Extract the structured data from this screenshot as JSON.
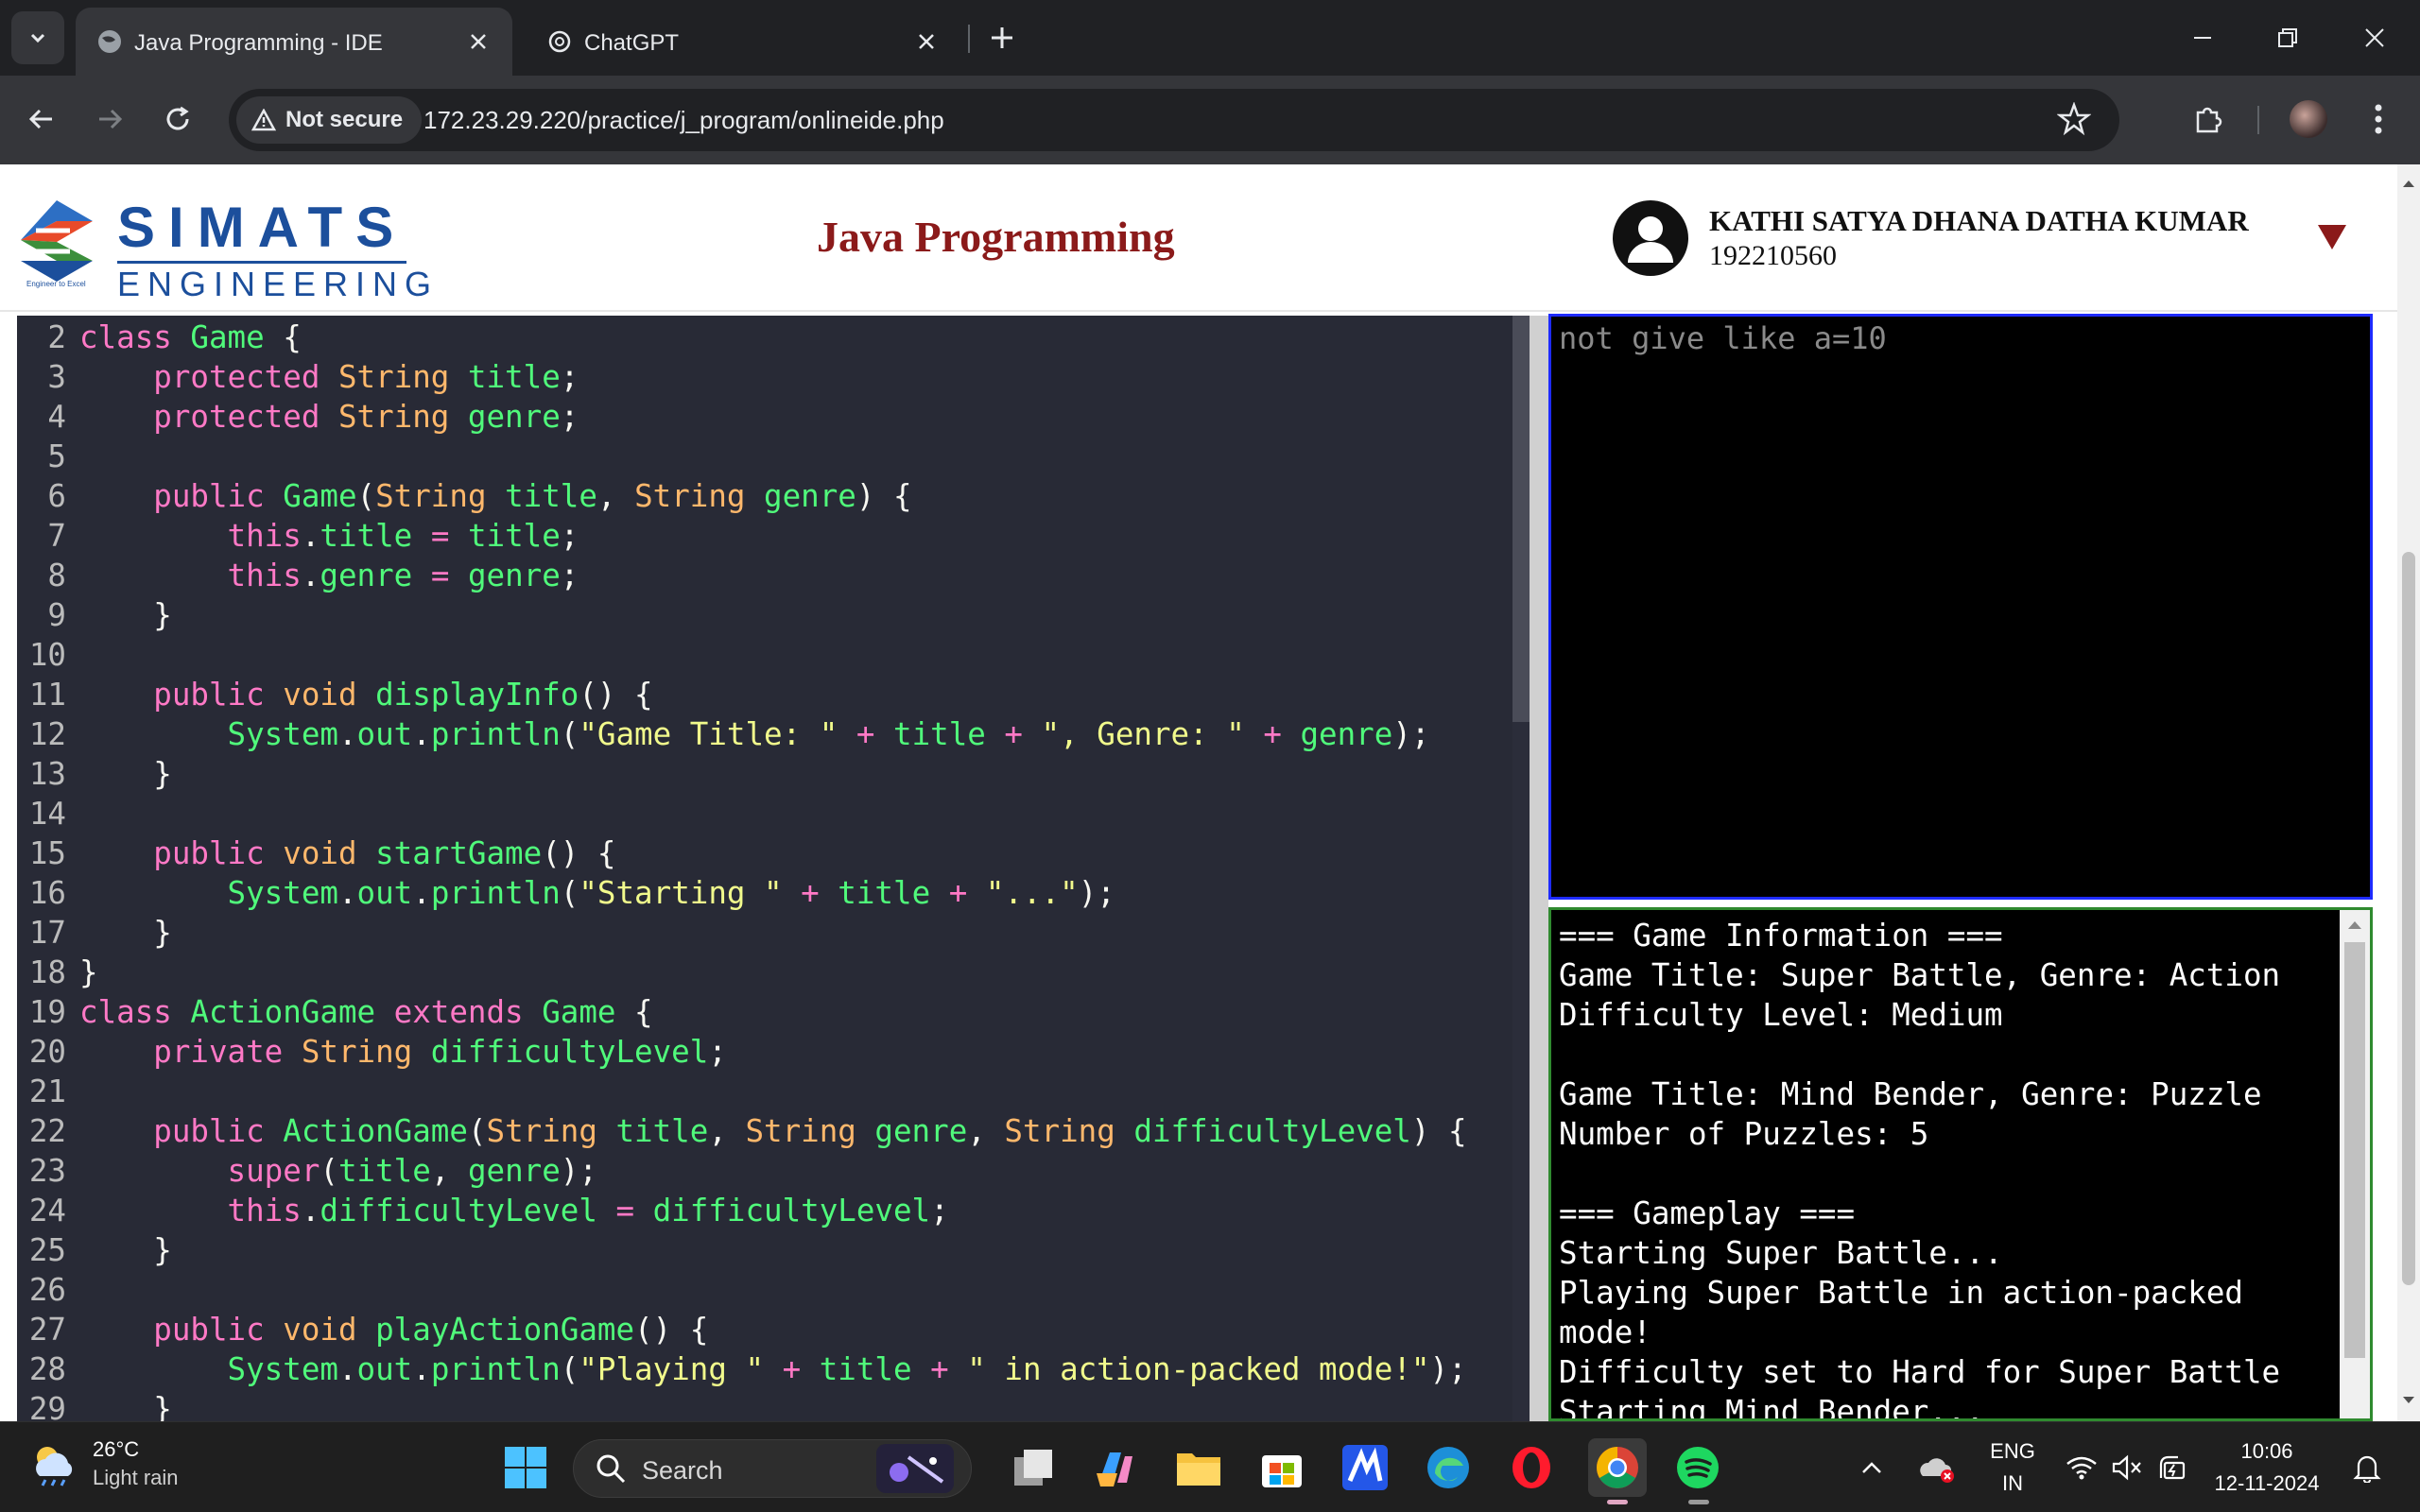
{
  "browser": {
    "tabs": [
      {
        "title": "Java Programming - IDE",
        "active": true
      },
      {
        "title": "ChatGPT",
        "active": false
      }
    ],
    "security_label": "Not secure",
    "url": "172.23.29.220/practice/j_program/onlineide.php"
  },
  "header": {
    "logo_word": "SIMATS",
    "logo_sub": "ENGINEERING",
    "logo_tagline": "Engineer to Excel",
    "title": "Java Programming",
    "user_name": "KATHI SATYA DHANA DATHA KUMAR",
    "user_id": "192210560"
  },
  "editor": {
    "lines": [
      {
        "n": "2",
        "tokens": [
          [
            "kw",
            "class "
          ],
          [
            "fn",
            "Game"
          ],
          [
            "pl",
            " {"
          ]
        ]
      },
      {
        "n": "3",
        "tokens": [
          [
            "pl",
            "    "
          ],
          [
            "kw",
            "protected "
          ],
          [
            "ty",
            "String "
          ],
          [
            "id",
            "title"
          ],
          [
            "pl",
            ";"
          ]
        ]
      },
      {
        "n": "4",
        "tokens": [
          [
            "pl",
            "    "
          ],
          [
            "kw",
            "protected "
          ],
          [
            "ty",
            "String "
          ],
          [
            "id",
            "genre"
          ],
          [
            "pl",
            ";"
          ]
        ]
      },
      {
        "n": "5",
        "tokens": []
      },
      {
        "n": "6",
        "tokens": [
          [
            "pl",
            "    "
          ],
          [
            "kw",
            "public "
          ],
          [
            "fn",
            "Game"
          ],
          [
            "pl",
            "("
          ],
          [
            "ty",
            "String "
          ],
          [
            "id",
            "title"
          ],
          [
            "pl",
            ", "
          ],
          [
            "ty",
            "String "
          ],
          [
            "id",
            "genre"
          ],
          [
            "pl",
            ") {"
          ]
        ]
      },
      {
        "n": "7",
        "tokens": [
          [
            "pl",
            "        "
          ],
          [
            "kw",
            "this"
          ],
          [
            "pl",
            "."
          ],
          [
            "id",
            "title"
          ],
          [
            "kw",
            " = "
          ],
          [
            "id",
            "title"
          ],
          [
            "pl",
            ";"
          ]
        ]
      },
      {
        "n": "8",
        "tokens": [
          [
            "pl",
            "        "
          ],
          [
            "kw",
            "this"
          ],
          [
            "pl",
            "."
          ],
          [
            "id",
            "genre"
          ],
          [
            "kw",
            " = "
          ],
          [
            "id",
            "genre"
          ],
          [
            "pl",
            ";"
          ]
        ]
      },
      {
        "n": "9",
        "tokens": [
          [
            "pl",
            "    }"
          ]
        ]
      },
      {
        "n": "10",
        "tokens": []
      },
      {
        "n": "11",
        "tokens": [
          [
            "pl",
            "    "
          ],
          [
            "kw",
            "public "
          ],
          [
            "ty",
            "void "
          ],
          [
            "fn",
            "displayInfo"
          ],
          [
            "pl",
            "() {"
          ]
        ]
      },
      {
        "n": "12",
        "tokens": [
          [
            "pl",
            "        "
          ],
          [
            "id",
            "System"
          ],
          [
            "pl",
            "."
          ],
          [
            "id",
            "out"
          ],
          [
            "pl",
            "."
          ],
          [
            "fn",
            "println"
          ],
          [
            "pl",
            "("
          ],
          [
            "st",
            "\"Game Title: \""
          ],
          [
            "kw",
            " + "
          ],
          [
            "id",
            "title"
          ],
          [
            "kw",
            " + "
          ],
          [
            "st",
            "\", Genre: \""
          ],
          [
            "kw",
            " + "
          ],
          [
            "id",
            "genre"
          ],
          [
            "pl",
            ");"
          ]
        ]
      },
      {
        "n": "13",
        "tokens": [
          [
            "pl",
            "    }"
          ]
        ]
      },
      {
        "n": "14",
        "tokens": []
      },
      {
        "n": "15",
        "tokens": [
          [
            "pl",
            "    "
          ],
          [
            "kw",
            "public "
          ],
          [
            "ty",
            "void "
          ],
          [
            "fn",
            "startGame"
          ],
          [
            "pl",
            "() {"
          ]
        ]
      },
      {
        "n": "16",
        "tokens": [
          [
            "pl",
            "        "
          ],
          [
            "id",
            "System"
          ],
          [
            "pl",
            "."
          ],
          [
            "id",
            "out"
          ],
          [
            "pl",
            "."
          ],
          [
            "fn",
            "println"
          ],
          [
            "pl",
            "("
          ],
          [
            "st",
            "\"Starting \""
          ],
          [
            "kw",
            " + "
          ],
          [
            "id",
            "title"
          ],
          [
            "kw",
            " + "
          ],
          [
            "st",
            "\"...\""
          ],
          [
            "pl",
            ");"
          ]
        ]
      },
      {
        "n": "17",
        "tokens": [
          [
            "pl",
            "    }"
          ]
        ]
      },
      {
        "n": "18",
        "tokens": [
          [
            "pl",
            "}"
          ]
        ]
      },
      {
        "n": "19",
        "tokens": [
          [
            "kw",
            "class "
          ],
          [
            "fn",
            "ActionGame "
          ],
          [
            "kw",
            "extends "
          ],
          [
            "fn",
            "Game"
          ],
          [
            "pl",
            " {"
          ]
        ]
      },
      {
        "n": "20",
        "tokens": [
          [
            "pl",
            "    "
          ],
          [
            "kw",
            "private "
          ],
          [
            "ty",
            "String "
          ],
          [
            "id",
            "difficultyLevel"
          ],
          [
            "pl",
            ";"
          ]
        ]
      },
      {
        "n": "21",
        "tokens": []
      },
      {
        "n": "22",
        "tokens": [
          [
            "pl",
            "    "
          ],
          [
            "kw",
            "public "
          ],
          [
            "fn",
            "ActionGame"
          ],
          [
            "pl",
            "("
          ],
          [
            "ty",
            "String "
          ],
          [
            "id",
            "title"
          ],
          [
            "pl",
            ", "
          ],
          [
            "ty",
            "String "
          ],
          [
            "id",
            "genre"
          ],
          [
            "pl",
            ", "
          ],
          [
            "ty",
            "String "
          ],
          [
            "id",
            "difficultyLevel"
          ],
          [
            "pl",
            ") {"
          ]
        ]
      },
      {
        "n": "23",
        "tokens": [
          [
            "pl",
            "        "
          ],
          [
            "kw",
            "super"
          ],
          [
            "pl",
            "("
          ],
          [
            "id",
            "title"
          ],
          [
            "pl",
            ", "
          ],
          [
            "id",
            "genre"
          ],
          [
            "pl",
            ");"
          ]
        ]
      },
      {
        "n": "24",
        "tokens": [
          [
            "pl",
            "        "
          ],
          [
            "kw",
            "this"
          ],
          [
            "pl",
            "."
          ],
          [
            "id",
            "difficultyLevel"
          ],
          [
            "kw",
            " = "
          ],
          [
            "id",
            "difficultyLevel"
          ],
          [
            "pl",
            ";"
          ]
        ]
      },
      {
        "n": "25",
        "tokens": [
          [
            "pl",
            "    }"
          ]
        ]
      },
      {
        "n": "26",
        "tokens": []
      },
      {
        "n": "27",
        "tokens": [
          [
            "pl",
            "    "
          ],
          [
            "kw",
            "public "
          ],
          [
            "ty",
            "void "
          ],
          [
            "fn",
            "playActionGame"
          ],
          [
            "pl",
            "() {"
          ]
        ]
      },
      {
        "n": "28",
        "tokens": [
          [
            "pl",
            "        "
          ],
          [
            "id",
            "System"
          ],
          [
            "pl",
            "."
          ],
          [
            "id",
            "out"
          ],
          [
            "pl",
            "."
          ],
          [
            "fn",
            "println"
          ],
          [
            "pl",
            "("
          ],
          [
            "st",
            "\"Playing \""
          ],
          [
            "kw",
            " + "
          ],
          [
            "id",
            "title"
          ],
          [
            "kw",
            " + "
          ],
          [
            "st",
            "\" in action-packed mode!\""
          ],
          [
            "pl",
            ");"
          ]
        ]
      },
      {
        "n": "29",
        "tokens": [
          [
            "pl",
            "    }"
          ]
        ]
      }
    ]
  },
  "input_panel": {
    "hint": "not give like a=10"
  },
  "output_panel": {
    "text": "=== Game Information ===\nGame Title: Super Battle, Genre: Action\nDifficulty Level: Medium\n\nGame Title: Mind Bender, Genre: Puzzle\nNumber of Puzzles: 5\n\n=== Gameplay ===\nStarting Super Battle...\nPlaying Super Battle in action-packed\nmode!\nDifficulty set to Hard for Super Battle\nStarting Mind Bender..."
  },
  "taskbar": {
    "weather_temp": "26°C",
    "weather_cond": "Light rain",
    "search_label": "Search",
    "lang_top": "ENG",
    "lang_bottom": "IN",
    "time": "10:06",
    "date": "12-11-2024"
  },
  "colors": {
    "editor_bg": "#282a36",
    "keyword": "#ff79c6",
    "type": "#ffb86c",
    "identifier": "#50fa7b",
    "string": "#f1fa8c",
    "title_red": "#8b1a1a",
    "logo_blue": "#1c4f9c"
  }
}
